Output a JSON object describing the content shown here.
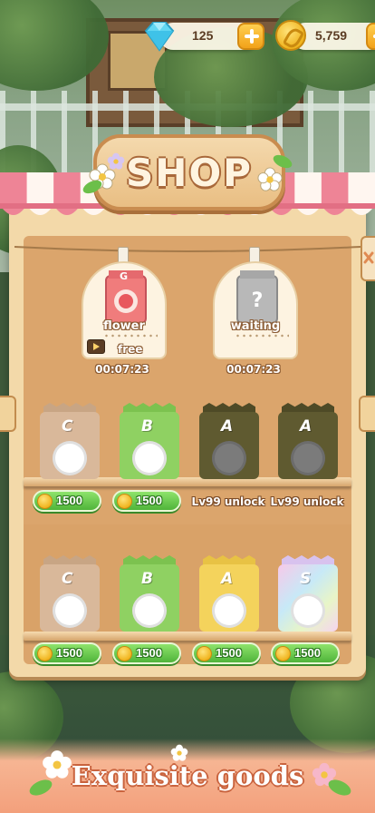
{
  "currency": {
    "gems": "125",
    "coins": "5,759"
  },
  "shop": {
    "title": "SHOP"
  },
  "special": [
    {
      "label": "flower",
      "sub": "free",
      "timer": "00:07:23",
      "badge": "G"
    },
    {
      "label": "waiting",
      "timer": "00:07:23"
    }
  ],
  "shelf1": [
    {
      "grade": "C",
      "color": "#d9b89a",
      "top": "#c8a584",
      "price": "1500",
      "locked": false
    },
    {
      "grade": "B",
      "color": "#8fd162",
      "top": "#7cc24f",
      "price": "1500",
      "locked": false
    },
    {
      "grade": "A",
      "color": "#5f5a30",
      "top": "#4e4a26",
      "lock_text": "Lv99 unlock",
      "locked": true
    },
    {
      "grade": "A",
      "color": "#5f5a30",
      "top": "#4e4a26",
      "lock_text": "Lv99 unlock",
      "locked": true
    }
  ],
  "shelf2": [
    {
      "grade": "C",
      "color": "#d9b89a",
      "top": "#c8a584",
      "price": "1500"
    },
    {
      "grade": "B",
      "color": "#8fd162",
      "top": "#7cc24f",
      "price": "1500"
    },
    {
      "grade": "A",
      "color": "#f4d35c",
      "top": "#e8c244",
      "price": "1500"
    },
    {
      "grade": "S",
      "color": "#e8d6f5",
      "top": "#d8c2ee",
      "price": "1500"
    }
  ],
  "banner": {
    "text": "Exquisite goods"
  },
  "colors": {
    "awning_red": "#ee8496",
    "awning_white": "#fff6f0",
    "price_green": "#4fb43a",
    "wood": "#dba56c"
  }
}
